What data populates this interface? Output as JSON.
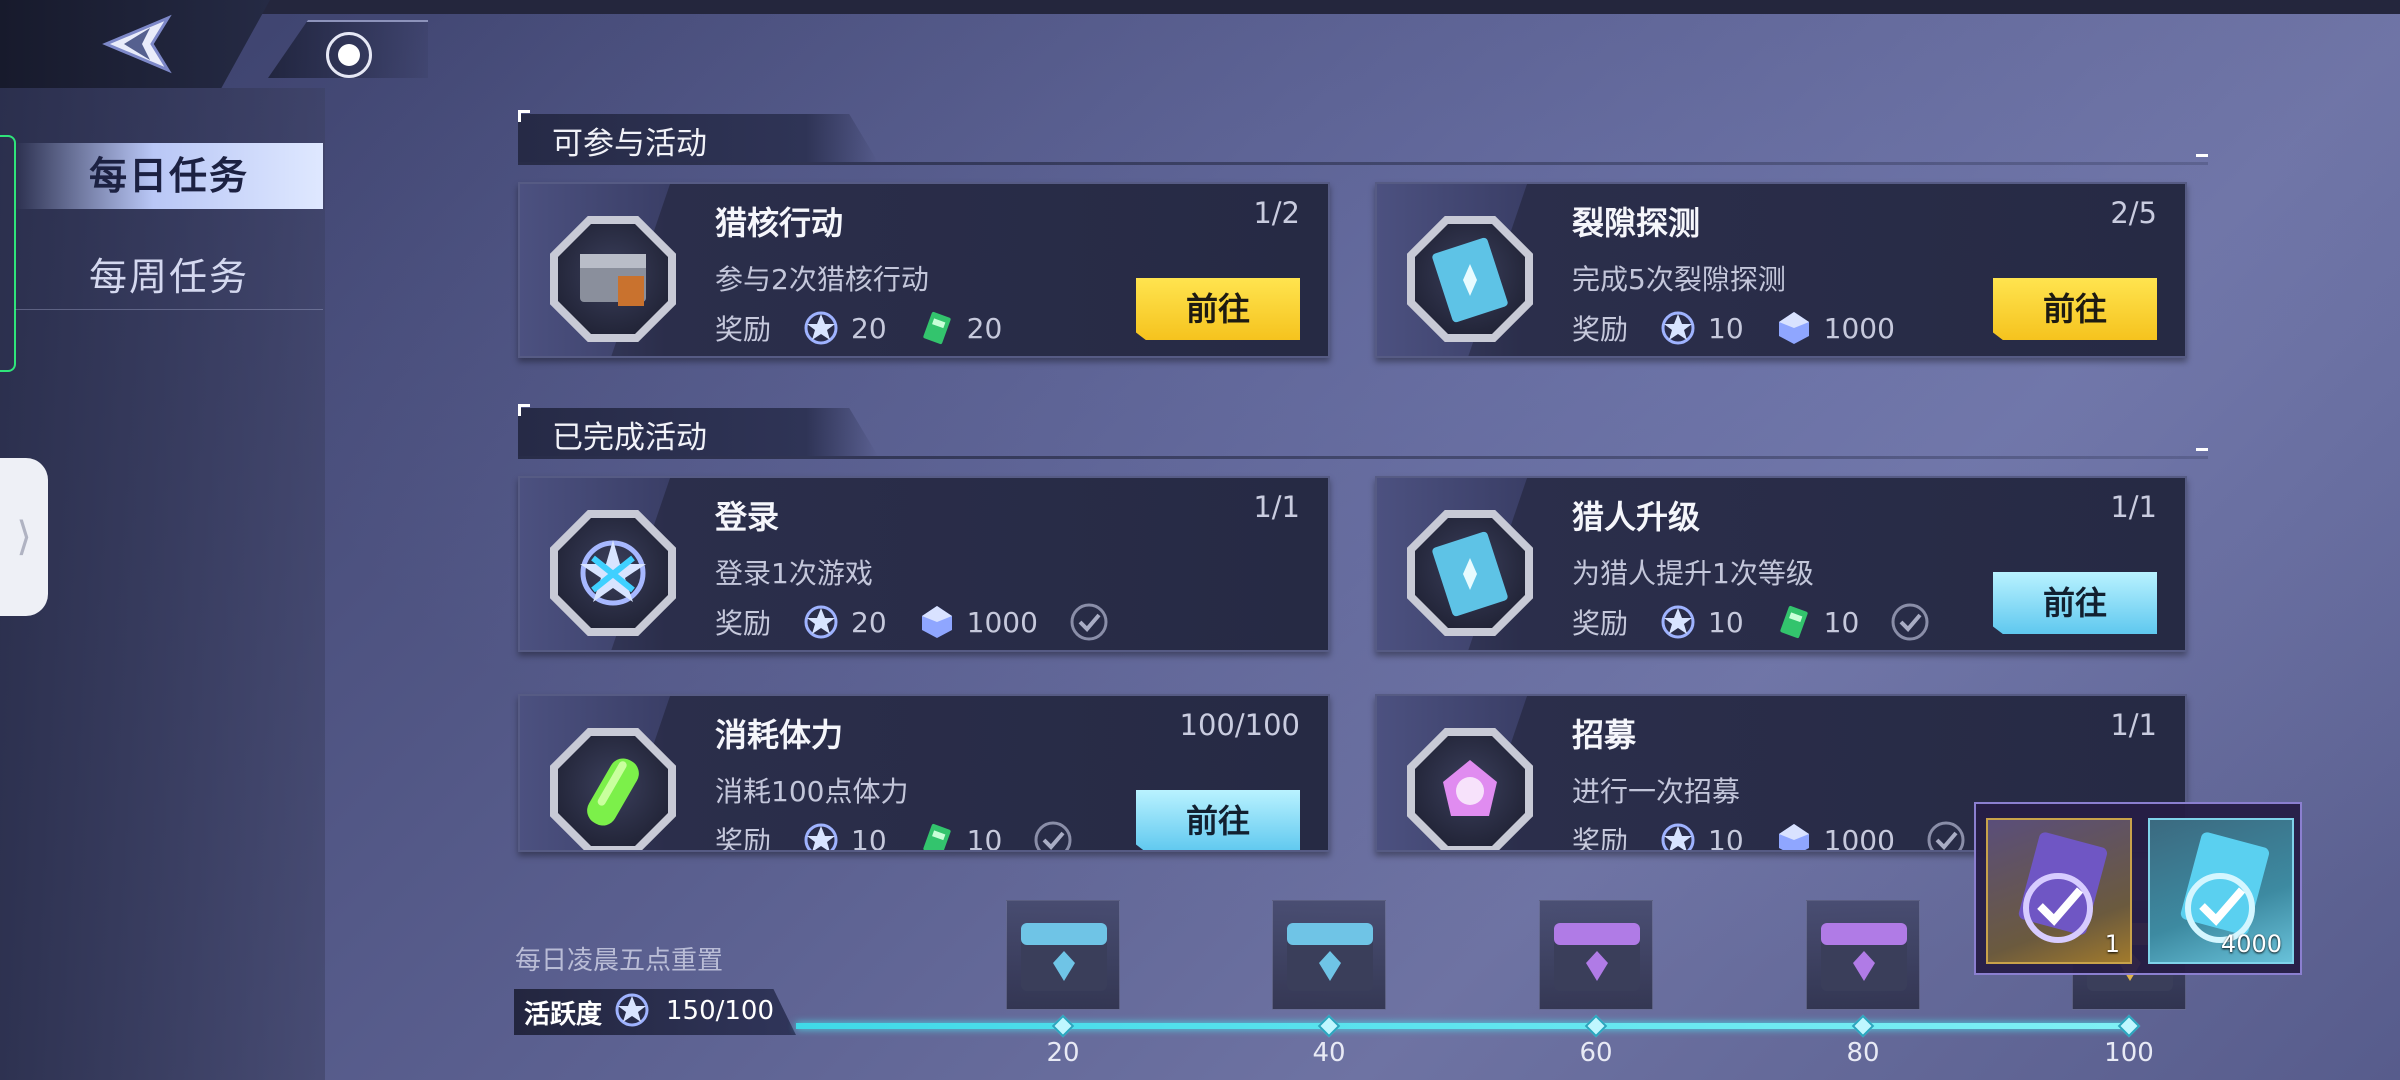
{
  "sidebar": {
    "tabs": [
      {
        "label": "每日任务",
        "active": true
      },
      {
        "label": "每周任务",
        "active": false
      }
    ]
  },
  "sections": [
    {
      "title": "可参与活动"
    },
    {
      "title": "已完成活动"
    }
  ],
  "reward_label": "奖励",
  "tasks": [
    {
      "title": "猎核行动",
      "progress": "1/2",
      "desc": "参与2次猎核行动",
      "rewards": [
        {
          "icon": "star-badge-icon",
          "value": "20"
        },
        {
          "icon": "green-ticket-icon",
          "value": "20"
        }
      ],
      "button": "前往",
      "button_style": "yellow",
      "completed": false
    },
    {
      "title": "裂隙探测",
      "progress": "2/5",
      "desc": "完成5次裂隙探测",
      "rewards": [
        {
          "icon": "star-badge-icon",
          "value": "10"
        },
        {
          "icon": "crystal-icon",
          "value": "1000"
        }
      ],
      "button": "前往",
      "button_style": "yellow",
      "completed": false
    },
    {
      "title": "登录",
      "progress": "1/1",
      "desc": "登录1次游戏",
      "rewards": [
        {
          "icon": "star-badge-icon",
          "value": "20"
        },
        {
          "icon": "crystal-icon",
          "value": "1000"
        }
      ],
      "button": "",
      "button_style": "none",
      "completed": true
    },
    {
      "title": "猎人升级",
      "progress": "1/1",
      "desc": "为猎人提升1次等级",
      "rewards": [
        {
          "icon": "star-badge-icon",
          "value": "10"
        },
        {
          "icon": "green-ticket-icon",
          "value": "10"
        }
      ],
      "button": "前往",
      "button_style": "blue",
      "completed": true
    },
    {
      "title": "消耗体力",
      "progress": "100/100",
      "desc": "消耗100点体力",
      "rewards": [
        {
          "icon": "star-badge-icon",
          "value": "10"
        },
        {
          "icon": "green-ticket-icon",
          "value": "10"
        }
      ],
      "button": "前往",
      "button_style": "blue",
      "completed": true
    },
    {
      "title": "招募",
      "progress": "1/1",
      "desc": "进行一次招募",
      "rewards": [
        {
          "icon": "star-badge-icon",
          "value": "10"
        },
        {
          "icon": "crystal-icon",
          "value": "1000"
        }
      ],
      "button": "",
      "button_style": "none",
      "completed": true
    }
  ],
  "activity": {
    "reset_text": "每日凌晨五点重置",
    "label": "活跃度",
    "value": "150/100",
    "progress_fraction": 1.0,
    "milestones": [
      "20",
      "40",
      "60",
      "80",
      "100"
    ]
  },
  "popup": {
    "items": [
      {
        "icon": "purple-check-medal-icon",
        "count": "1"
      },
      {
        "icon": "cyan-ticket-medal-icon",
        "count": "4000"
      }
    ]
  },
  "colors": {
    "accent_cyan": "#4fe0ee",
    "button_yellow": "#f5c31e",
    "button_blue": "#5fc8ef",
    "sidebar_accent": "#2fe47a"
  }
}
